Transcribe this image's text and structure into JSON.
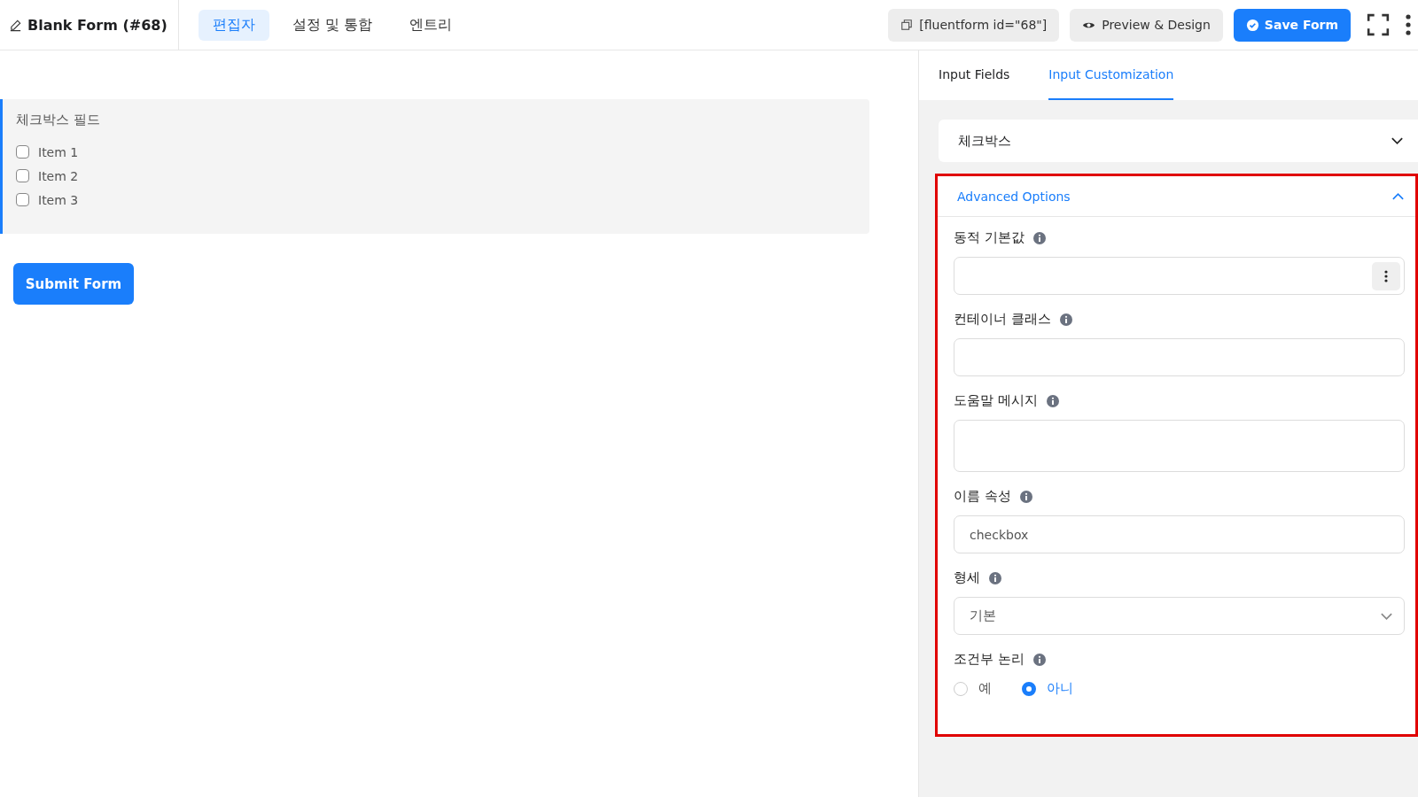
{
  "header": {
    "title": "Blank Form (#68)",
    "tabs": [
      {
        "label": "편집자",
        "selected": true
      },
      {
        "label": "설정 및 통합",
        "selected": false
      },
      {
        "label": "엔트리",
        "selected": false
      }
    ],
    "shortcode": "[fluentform id=\"68\"]",
    "preview_button": "Preview & Design",
    "save_button": "Save Form"
  },
  "form": {
    "field_label": "체크박스 필드",
    "options": [
      {
        "label": "Item 1",
        "checked": false
      },
      {
        "label": "Item 2",
        "checked": false
      },
      {
        "label": "Item 3",
        "checked": false
      }
    ],
    "submit_button": "Submit Form"
  },
  "sidebar": {
    "tabs": [
      {
        "label": "Input Fields",
        "selected": false
      },
      {
        "label": "Input Customization",
        "selected": true
      }
    ],
    "field_type": {
      "label": "체크박스",
      "expanded": false
    },
    "advanced": {
      "title": "Advanced Options",
      "expanded": true,
      "highlighted": true,
      "fields": [
        {
          "kind": "menu-input",
          "label": "동적 기본값"
        },
        {
          "kind": "input",
          "label": "컨테이너 클래스"
        },
        {
          "kind": "textarea",
          "label": "도움말 메시지"
        },
        {
          "kind": "input",
          "label": "이름 속성",
          "value": "checkbox"
        },
        {
          "kind": "select",
          "label": "형세",
          "value": "기본"
        },
        {
          "kind": "radio",
          "label": "조건부 논리",
          "options": [
            {
              "label": "예",
              "selected": false
            },
            {
              "label": "아니",
              "selected": true
            }
          ]
        }
      ]
    }
  }
}
